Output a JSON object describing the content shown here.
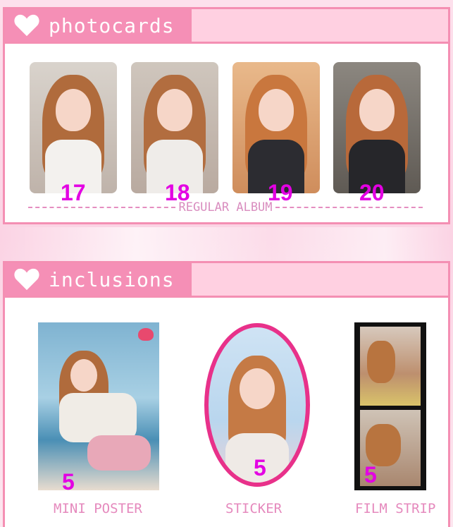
{
  "photocards": {
    "title": "photocards",
    "cards": [
      {
        "number": "17"
      },
      {
        "number": "18"
      },
      {
        "number": "19"
      },
      {
        "number": "20"
      }
    ],
    "divider_label": "REGULAR ALBUM"
  },
  "inclusions": {
    "title": "inclusions",
    "items": [
      {
        "label": "MINI POSTER",
        "count": "5"
      },
      {
        "label": "STICKER",
        "count": "5"
      },
      {
        "label": "FILM STRIP",
        "count": "5"
      }
    ]
  },
  "colors": {
    "accent_pink": "#f58fb6",
    "number_magenta": "#e300e3",
    "label_pink": "#e589bd"
  }
}
